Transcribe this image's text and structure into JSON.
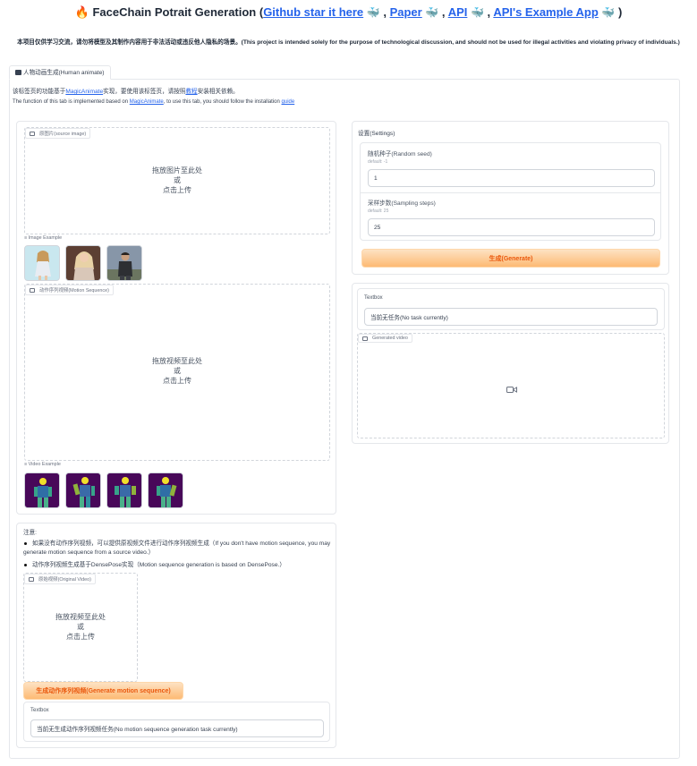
{
  "header": {
    "title_prefix": "FaceChain Potrait Generation (",
    "link_github": "Github star it here",
    "sep1": " ,",
    "link_paper": "Paper",
    "sep2": " ,",
    "link_api": "API",
    "sep3": " ,",
    "link_api_example": "API's Example App",
    "title_suffix": " )",
    "disclaimer": "本项目仅供学习交流，请勿将模型及其制作内容用于非法活动或违反他人隐私的场景。(This project is intended solely for the purpose of technological discussion, and should not be used for illegal activities and violating privacy of individuals.)"
  },
  "tab": {
    "label": "人物动画生成(Human animate)"
  },
  "intro": {
    "zh_prefix": "该标签页的功能基于",
    "zh_link1": "MagicAnimate",
    "zh_mid": "实现，要使用该标签页，请按照",
    "zh_link2": "教程",
    "zh_suffix": "安装相关依赖。",
    "en_prefix": "The function of this tab is implemented based on ",
    "en_link1": "MagicAnimate",
    "en_mid": ", to use this tab, you should follow the installation ",
    "en_link2": "guide"
  },
  "source_image": {
    "label": "原图片(source image)",
    "drop_line1": "拖放图片至此处",
    "drop_line2": "或",
    "drop_line3": "点击上传"
  },
  "image_example": {
    "label": "Image Example"
  },
  "motion_sequence": {
    "label": "动作序列视频(Motion Sequence)",
    "drop_line1": "拖放视频至此处",
    "drop_line2": "或",
    "drop_line3": "点击上传"
  },
  "video_example": {
    "label": "Video Example"
  },
  "settings": {
    "title": "设置(Settings)",
    "seed_label": "随机种子(Random seed)",
    "seed_default": "default: -1",
    "seed_value": "1",
    "steps_label": "采样步数(Sampling steps)",
    "steps_default": "default: 25",
    "steps_value": "25",
    "generate_button": "生成(Generate)"
  },
  "output": {
    "textbox_label": "Textbox",
    "textbox_value": "当前无任务(No task currently)",
    "video_label": "Generated video"
  },
  "notes": {
    "title": "注意:",
    "item1": "如果没有动作序列视频，可以提供原视频文件进行动作序列视频生成（If you don't have motion sequence, you may generate motion sequence from a source video.）",
    "item2": "动作序列视频生成基于DensePose实现（Motion sequence generation is based on DensePose.）"
  },
  "original_video": {
    "label": "原始视频(Original Video)",
    "drop_line1": "拖放视频至此处",
    "drop_line2": "或",
    "drop_line3": "点击上传",
    "generate_button": "生成动作序列视频(Generate motion sequence)",
    "textbox_label": "Textbox",
    "textbox_value": "当前无生成动作序列视频任务(No motion sequence generation task currently)"
  },
  "colors": {
    "accent_orange": "#ea580c",
    "button_bg": "#fdba74",
    "link_blue": "#2563eb",
    "densepose_bg": "#4a0a5a"
  }
}
